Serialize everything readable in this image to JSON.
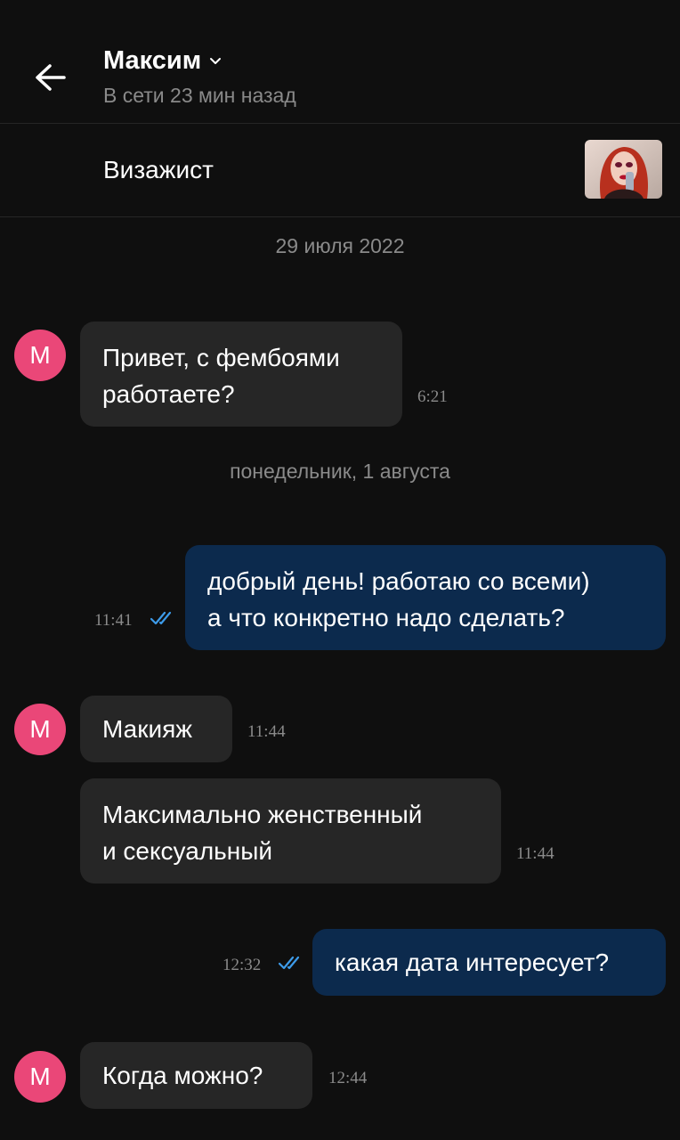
{
  "header": {
    "name": "Максим",
    "status": "В сети 23 мин назад"
  },
  "listing": {
    "title": "Визажист"
  },
  "dates": {
    "first": "29 июля 2022",
    "second": "понедельник, 1 августа"
  },
  "avatar_letter": "M",
  "colors": {
    "background": "#0f0f0f",
    "incoming_bubble": "#262626",
    "outgoing_bubble": "#0c2a4d",
    "avatar": "#ea4778",
    "check": "#3d9be9"
  },
  "messages": [
    {
      "dir": "in",
      "lines": [
        "Привет, с фембоями",
        "работаете?"
      ],
      "time": "6:21"
    },
    {
      "dir": "out",
      "lines": [
        "добрый день! работаю со всеми)",
        "а что конкретно надо сделать?"
      ],
      "time": "11:41",
      "read": true
    },
    {
      "dir": "in",
      "lines": [
        "Макияж"
      ],
      "time": "11:44"
    },
    {
      "dir": "in",
      "lines": [
        "Максимально женственный",
        "и сексуальный"
      ],
      "time": "11:44"
    },
    {
      "dir": "out",
      "lines": [
        "какая дата интересует?"
      ],
      "time": "12:32",
      "read": true
    },
    {
      "dir": "in",
      "lines": [
        "Когда можно?"
      ],
      "time": "12:44"
    }
  ]
}
